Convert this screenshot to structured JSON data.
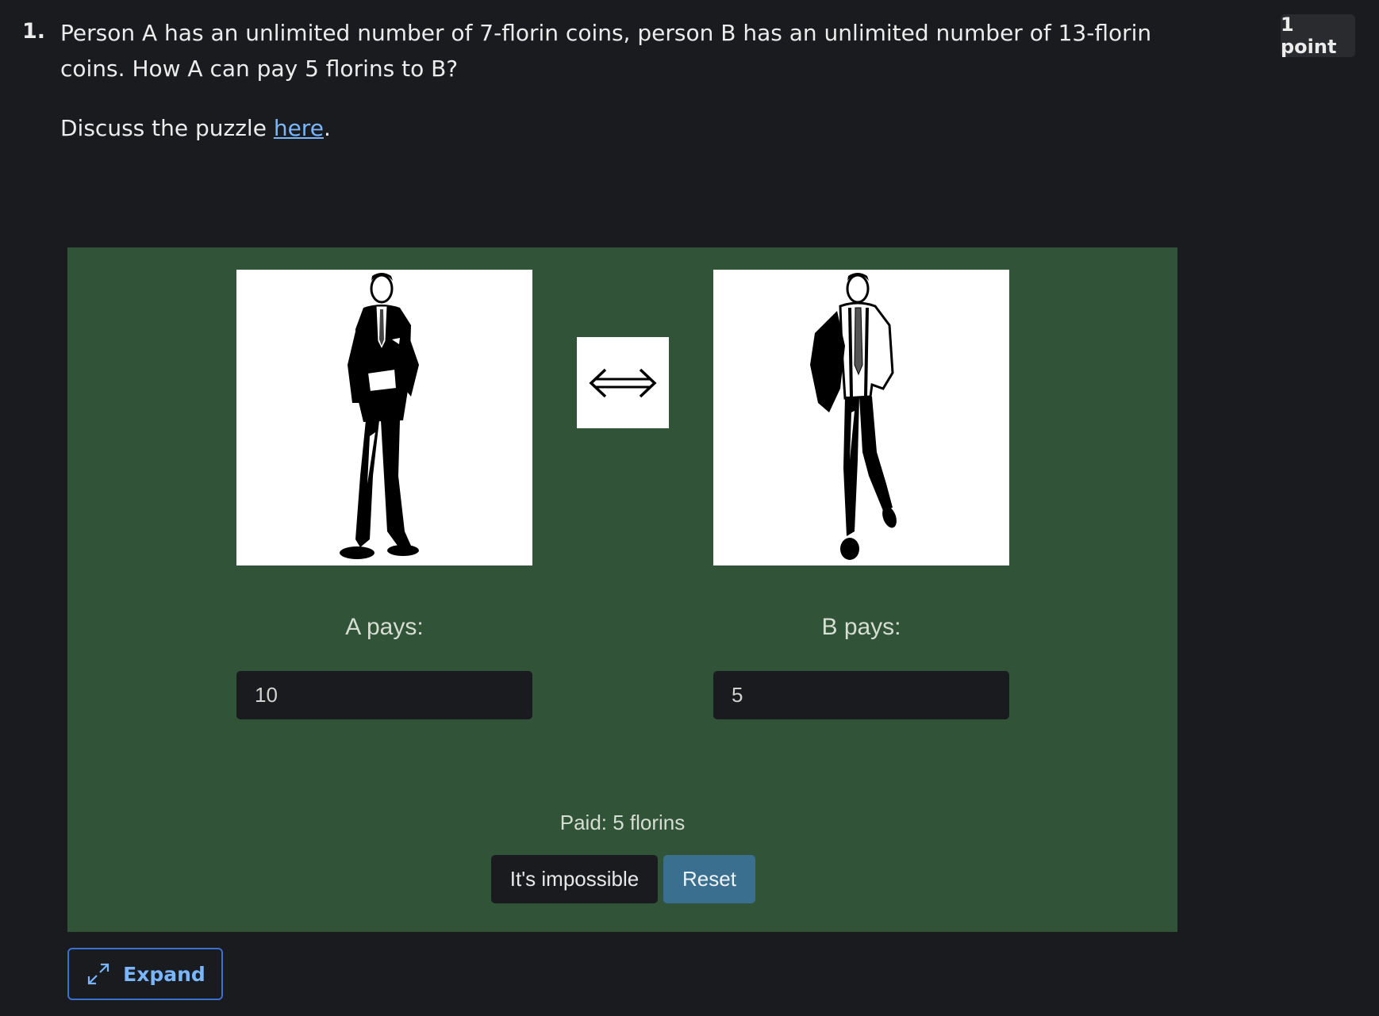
{
  "question": {
    "number": "1.",
    "text": "Person A has an unlimited number of 7-florin coins, person B has an unlimited number of 13-florin coins. How A can pay 5 florins to B?",
    "discuss_prefix": "Discuss the puzzle ",
    "discuss_link": "here",
    "discuss_suffix": ".",
    "points": "1 point"
  },
  "widget": {
    "label_a": "A pays:",
    "label_b": "B pays:",
    "value_a": "10",
    "value_b": "5",
    "status": "Paid: 5 florins",
    "impossible_label": "It's impossible",
    "reset_label": "Reset"
  },
  "expand_label": "Expand",
  "icons": {
    "arrow": "double-headed-arrow-icon",
    "expand": "expand-diagonal-icon"
  },
  "colors": {
    "page_bg": "#1a1b1e",
    "panel_bg": "#315337",
    "reset_button": "#3a6f90",
    "link": "#79b6ff"
  }
}
